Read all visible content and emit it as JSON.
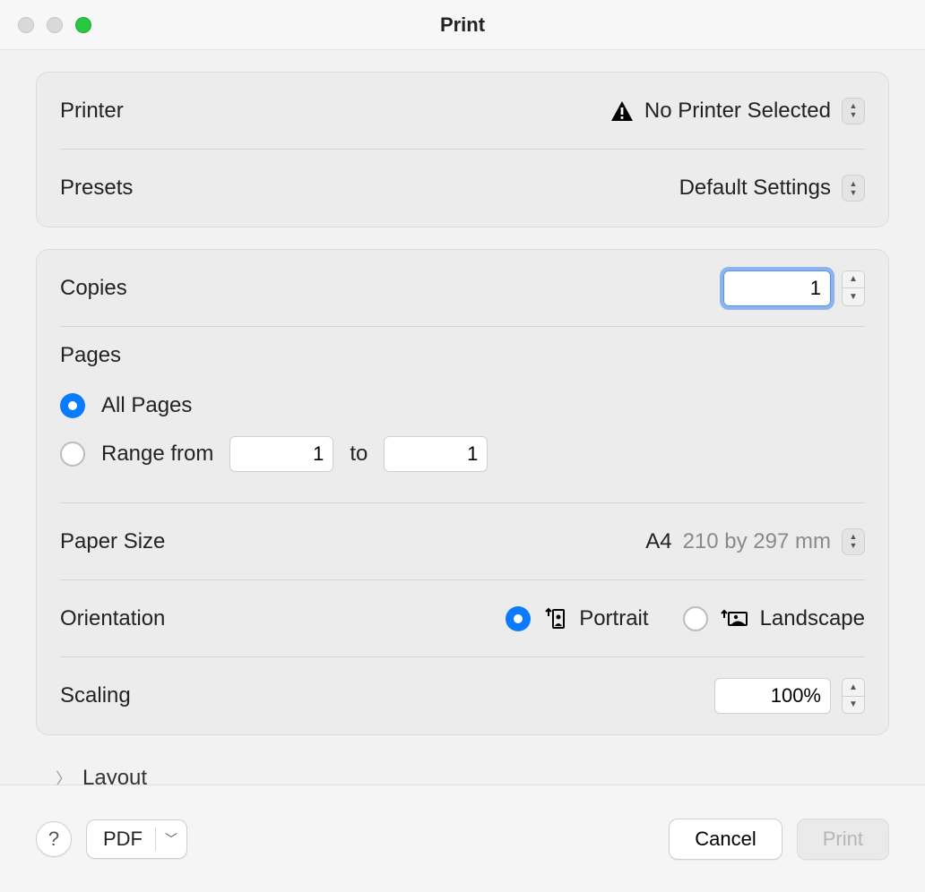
{
  "window": {
    "title": "Print"
  },
  "printer": {
    "label": "Printer",
    "value": "No Printer Selected"
  },
  "presets": {
    "label": "Presets",
    "value": "Default Settings"
  },
  "copies": {
    "label": "Copies",
    "value": "1"
  },
  "pages": {
    "title": "Pages",
    "all_label": "All Pages",
    "range_label": "Range from",
    "range_to": "to",
    "range_start": "1",
    "range_end": "1",
    "selected": "all"
  },
  "paper_size": {
    "label": "Paper Size",
    "value": "A4",
    "dimensions": "210 by 297 mm"
  },
  "orientation": {
    "label": "Orientation",
    "portrait": "Portrait",
    "landscape": "Landscape",
    "selected": "portrait"
  },
  "scaling": {
    "label": "Scaling",
    "value": "100%"
  },
  "layout": {
    "label": "Layout"
  },
  "footer": {
    "help": "?",
    "pdf": "PDF",
    "cancel": "Cancel",
    "print": "Print"
  }
}
